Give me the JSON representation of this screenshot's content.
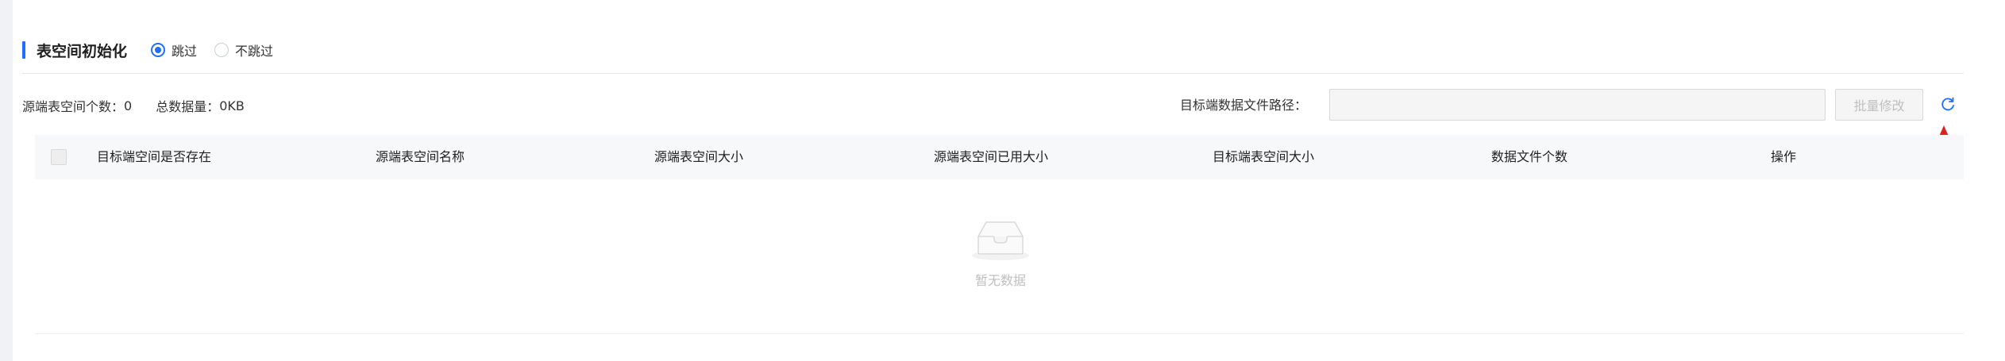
{
  "section": {
    "title": "表空间初始化",
    "options": [
      {
        "label": "跳过",
        "checked": true
      },
      {
        "label": "不跳过",
        "checked": false
      }
    ]
  },
  "stats": {
    "count_label": "源端表空间个数：",
    "count_value": "0",
    "size_label": "总数据量：",
    "size_value": "0KB"
  },
  "path": {
    "label": "目标端数据文件路径：",
    "value": ""
  },
  "toolbar": {
    "batch_label": "批量修改",
    "refresh_icon": "refresh-icon"
  },
  "table": {
    "columns": [
      "目标端空间是否存在",
      "源端表空间名称",
      "源端表空间大小",
      "源端表空间已用大小",
      "目标端表空间大小",
      "数据文件个数",
      "操作"
    ],
    "rows": [],
    "empty_text": "暂无数据"
  },
  "colors": {
    "accent": "#1e6fff",
    "annotation_arrow": "#e02020"
  }
}
